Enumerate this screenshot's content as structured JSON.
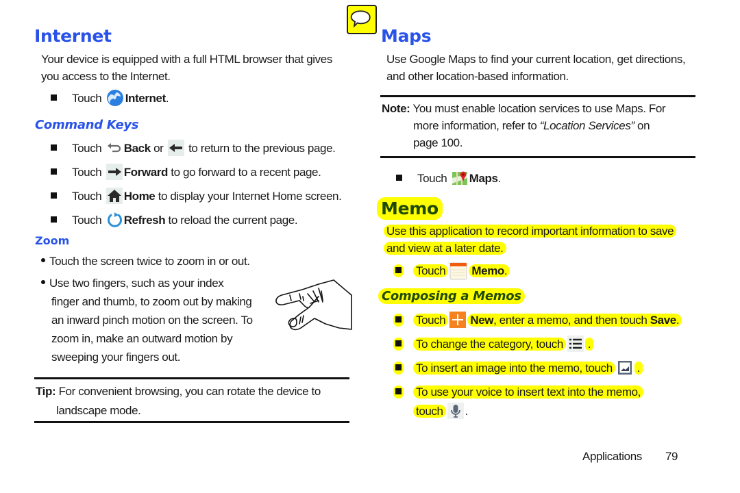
{
  "left": {
    "internet": {
      "title": "Internet",
      "intro_line1": "Your device is equipped with a full HTML browser that gives",
      "intro_line2": "you access to the Internet.",
      "touch_label": "Touch",
      "app_label": "Internet",
      "period": "."
    },
    "command_keys": {
      "title": "Command Keys",
      "items": [
        {
          "pre": "Touch",
          "bold": "Back",
          "mid": "or",
          "post": "to return to the previous page."
        },
        {
          "pre": "Touch",
          "bold": "Forward",
          "post": "to go forward to a recent page."
        },
        {
          "pre": "Touch",
          "bold": "Home",
          "post": "to display your Internet Home screen."
        },
        {
          "pre": "Touch",
          "bold": "Refresh",
          "post": "to reload the current page."
        }
      ]
    },
    "zoom": {
      "title": "Zoom",
      "bullet1": "Touch the screen twice to zoom in or out.",
      "bullet2_lines": [
        "Use two fingers, such as your index",
        "finger and thumb, to zoom out by making",
        "an inward pinch motion on the screen. To",
        "zoom in, make an outward motion by",
        "sweeping your fingers out."
      ]
    },
    "tip": {
      "label": "Tip:",
      "line1": "For convenient browsing, you can rotate the device to",
      "line2": "landscape mode."
    }
  },
  "right": {
    "maps": {
      "title": "Maps",
      "intro_line1": "Use Google Maps to find your current location, get directions,",
      "intro_line2": "and other location-based information.",
      "touch_label": "Touch",
      "app_label": "Maps",
      "period": "."
    },
    "note": {
      "label": "Note:",
      "line1": "You must enable location services to use Maps. For",
      "line2_pre": "more information, refer to",
      "line2_ref": "“Location Services”",
      "line2_post": "on",
      "line3": "page 100."
    },
    "memo": {
      "title": "Memo",
      "intro_line1": "Use this application to record important information to save",
      "intro_line2": "and view at a later date.",
      "touch_label": "Touch",
      "app_label": "Memo",
      "period": "."
    },
    "composing": {
      "title": "Composing a Memos",
      "items": [
        {
          "pre": "Touch",
          "bold": "New",
          "post": ", enter a memo, and then touch",
          "bold2": "Save",
          "end": "."
        },
        {
          "pre": "To change the category, touch",
          "end": "."
        },
        {
          "pre": "To insert an image into the memo, touch",
          "end": "."
        },
        {
          "pre": "To use your voice to insert text into the memo,",
          "line2": "touch",
          "end": "."
        }
      ]
    }
  },
  "footer": {
    "section": "Applications",
    "page_number": "79"
  },
  "colors": {
    "heading_blue": "#2953e8",
    "highlight_yellow": "#ffff00",
    "highlight_text": "#1f4a06"
  }
}
